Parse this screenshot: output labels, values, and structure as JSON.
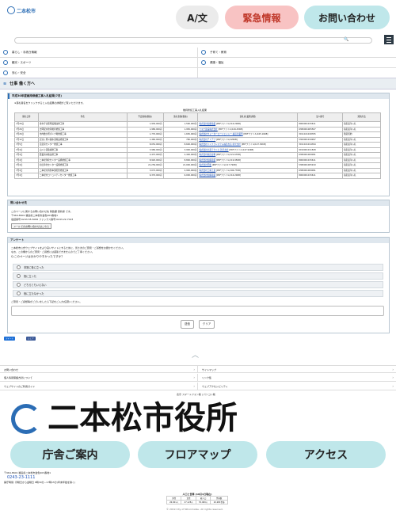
{
  "header": {
    "logo_text": "二本松市",
    "lang_button": "A/文",
    "emergency_button": "緊急情報",
    "contact_button": "お問い合わせ",
    "colors": {
      "emergency": "#f8c3c3",
      "contact": "#bfe7ea",
      "lang": "#ebebeb",
      "brand": "#2b6db5"
    }
  },
  "search": {
    "placeholder": "",
    "icon": "search-icon"
  },
  "nav": [
    {
      "label": "暮らし・手続き情報",
      "icon": "home-icon"
    },
    {
      "label": "子育て・教育",
      "icon": "child-icon"
    },
    {
      "label": "観光・スポーツ",
      "icon": "flag-icon"
    },
    {
      "label": "健康・福祉",
      "icon": "heart-icon"
    },
    {
      "label": "安心・安全",
      "icon": "shield-icon"
    }
  ],
  "breadcrumb": {
    "title": "仕事 働く方へ"
  },
  "main": {
    "article_title": "平成30年度維持修繕工事入札結果(7月)",
    "note": "※落札者名をクリックすると入札結果の詳細がご覧いただけます。",
    "table_caption": "維持修繕工事入札結果",
    "columns": [
      "開札日等",
      "件名",
      "予定価格(税抜)",
      "落札金額(税抜)",
      "落札者(業務詳細)",
      "法人番号",
      "契約方法"
    ],
    "rows": [
      [
        "7月26日",
        "金市庁舎照明設備改修工事",
        "1,930,000円",
        "1,590,000円",
        "株式会社加藤電業",
        "[PDFファイル/116.20KB]",
        "8000001015611",
        "指名競争入札"
      ],
      [
        "7月26日",
        "吉岡配水池等維持修繕工事",
        "1,980,000円",
        "1,950,000円",
        "ヤマナ建設株式会社",
        "[PDFファイル/126.45KB]",
        "6380001005507",
        "指名競争入札"
      ],
      [
        "7月26日",
        "市内数か所ポンプ場修繕工事",
        "1,770,000円",
        "1,650,000円",
        "株式会社ウォーターエージェンシー 福島営業所",
        "[PDFファイル/165.16KB]",
        "3011101018765",
        "随意契約"
      ],
      [
        "7月12日",
        "安達ヶ原公園水道施設修繕工事",
        "1,460,000円",
        "780,000円",
        "株式会社アドアプ",
        "[PDFファイル/120KB]",
        "5300001019997",
        "指名競争入札"
      ],
      [
        "7月5日",
        "岳温泉センター修繕工事",
        "8,052,000円",
        "8,600,000円",
        "株式会社インフラシステム福島支店 新光支社",
        "[PDFファイル/147.30KB]",
        "3011101014394",
        "指名競争入札"
      ],
      [
        "7月4日",
        "山入り道路補修工事",
        "3,980,000円",
        "3,900,000円",
        "株式会社大東テクニカ 新光支社",
        "[PDFファイル/147.94KB]",
        "9010001011828",
        "指名競争入札"
      ],
      [
        "7月4日",
        "農業用水路改修工事",
        "2,437,000円",
        "2,400,000円",
        "株式会社福島設備",
        "[PDFファイル/121.67KB]",
        "6380001009091",
        "指名競争入札"
      ],
      [
        "7月4日",
        "二本松浄化センター設備修繕工事",
        "8,920,000円",
        "8,800,000円",
        "株式会社加藤電業",
        "[PDFファイル/119.95KB]",
        "8000001015611",
        "指名競争入札"
      ],
      [
        "7月4日",
        "杉田浄化センター設備修繕工事",
        "21,259,000円",
        "21,000,000円",
        "株式会社明和",
        "[PDFファイル/117.79KB]",
        "5380001005919",
        "指名競争入札"
      ],
      [
        "7月4日",
        "二本松市消防本部配管修繕工事",
        "3,072,000円",
        "2,900,000円",
        "株式会社工藤工業",
        "[PDFファイル/106.77KB]",
        "6380001009091",
        "指名競争入札"
      ],
      [
        "7月4日",
        "二本松市コミュニティセンター修繕工事",
        "6,370,000円",
        "6,000,000円",
        "株式会社加藤電業",
        "[PDFファイル/116.20KB]",
        "8000001015611",
        "指名競争入札"
      ]
    ]
  },
  "inquiry": {
    "heading": "問い合わせ先",
    "line1": "このページに関するお問い合わせ先 財政課 契約係 です。",
    "line2": "〒964-8601 福島県二本松市金色403番地1",
    "line3": "電話番号:0243-55-5082 ファックス番号:0243-22-7023",
    "mail_button": "メールでのお問い合わせはこちら"
  },
  "survey": {
    "heading": "アンケート",
    "intro1": "二本松市公式ウェブサイトをより良いサイトにするために、皆さまのご意見・ご感想をお聞かせください。",
    "intro2": "なお、この欄からのご意見・ご感想には返答できませんのでご了承ください。",
    "question": "Q.このページは分かりやすかったですか？",
    "options": [
      "非常に役に立った",
      "役に立った",
      "どちらともいえない",
      "役に立たなかった"
    ],
    "comment_label": "ご意見・ご感想等がございましたら下記をご入力(任意)ください。",
    "submit": "送信",
    "clear": "クリア"
  },
  "share": {
    "twitter": "ツイート",
    "facebook": "シェア"
  },
  "footer_links": [
    [
      "お問い合わせ",
      "サイトマップ"
    ],
    [
      "個人情報保護方針について",
      "リンク集"
    ],
    [
      "ウェブサイトのご利用ガイド",
      "ウェブアクセシビリティ"
    ]
  ],
  "footer_small": "表示 スマートフォン版 | パソコン版",
  "footer": {
    "city_name": "二本松市役所",
    "buttons": [
      "庁舎ご案内",
      "フロアマップ",
      "アクセス"
    ],
    "address": "〒964-8601 福島県二本松市金色403番地1",
    "phone": "0243-23-1111",
    "hours": "開庁時間: 月曜日から金曜日 8時30分~17時15分(年末年始を除く)",
    "counter_label": "人口と世帯 (10月1日現在)",
    "counter_headers": [
      "男性",
      "女性",
      "総人口",
      "世帯数"
    ],
    "counter_values": [
      "26,841人",
      "27,128人",
      "53,969人",
      "20,981世帯"
    ],
    "copyright": "© 2019 City of Nihonmatsu. All rights reserved."
  }
}
